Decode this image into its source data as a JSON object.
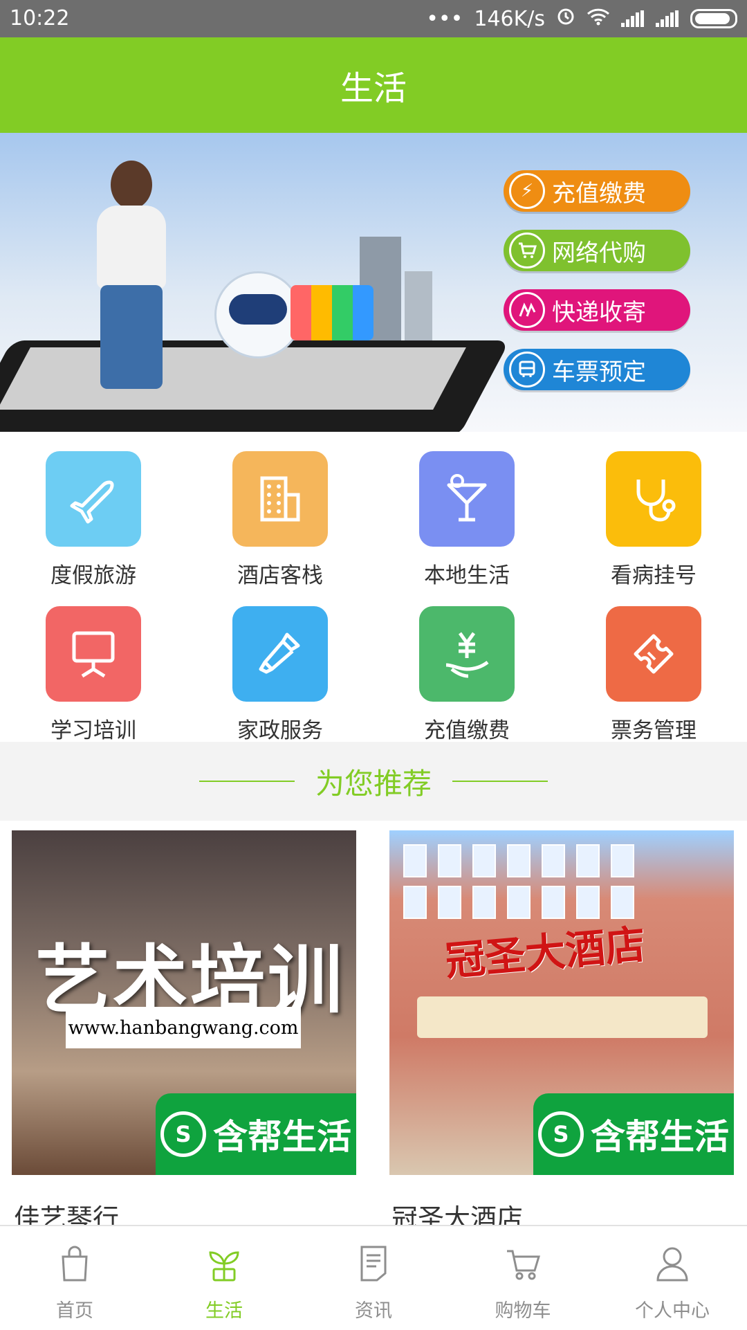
{
  "status_bar": {
    "time": "10:22",
    "dots": "•••",
    "speed": "146K/s",
    "icons": [
      "alarm-icon",
      "wifi-icon",
      "signal-icon",
      "signal-icon",
      "battery-icon"
    ]
  },
  "header": {
    "title": "生活"
  },
  "banner": {
    "pills": [
      {
        "label": "充值缴费",
        "color": "#ef8d12",
        "icon": "bolt-icon"
      },
      {
        "label": "网络代购",
        "color": "#7fc12e",
        "icon": "cart-icon"
      },
      {
        "label": "快递收寄",
        "color": "#e0157b",
        "icon": "delivery-icon"
      },
      {
        "label": "车票预定",
        "color": "#1f86d6",
        "icon": "bus-icon"
      }
    ]
  },
  "categories": [
    {
      "label": "度假旅游",
      "color": "#6dcdf3",
      "icon": "airplane-icon"
    },
    {
      "label": "酒店客栈",
      "color": "#f5b65b",
      "icon": "building-icon"
    },
    {
      "label": "本地生活",
      "color": "#7a8ff2",
      "icon": "cocktail-icon"
    },
    {
      "label": "看病挂号",
      "color": "#fbbd0b",
      "icon": "stethoscope-icon"
    },
    {
      "label": "学习培训",
      "color": "#f26665",
      "icon": "presentation-icon"
    },
    {
      "label": "家政服务",
      "color": "#3eaff0",
      "icon": "cleaning-icon"
    },
    {
      "label": "充值缴费",
      "color": "#4cb86b",
      "icon": "yuan-hand-icon"
    },
    {
      "label": "票务管理",
      "color": "#ee6a45",
      "icon": "ticket-icon"
    }
  ],
  "recommend": {
    "title": "为您推荐",
    "cards": [
      {
        "overlay": "艺术培训",
        "url": "www.hanbangwang.com",
        "brand": "含帮生活",
        "name": "佳艺琴行"
      },
      {
        "overlay": "冠圣大酒店",
        "brand": "含帮生活",
        "name": "冠圣大酒店"
      }
    ]
  },
  "tabbar": {
    "tabs": [
      {
        "label": "首页",
        "icon": "shopping-bag-icon",
        "active": false
      },
      {
        "label": "生活",
        "icon": "sprout-icon",
        "active": true
      },
      {
        "label": "资讯",
        "icon": "document-icon",
        "active": false
      },
      {
        "label": "购物车",
        "icon": "cart-icon",
        "active": false
      },
      {
        "label": "个人中心",
        "icon": "person-icon",
        "active": false
      }
    ]
  },
  "colors": {
    "accent": "#82cc25",
    "statusbar": "#6e6e6e",
    "brand_green": "#0fa33e"
  }
}
